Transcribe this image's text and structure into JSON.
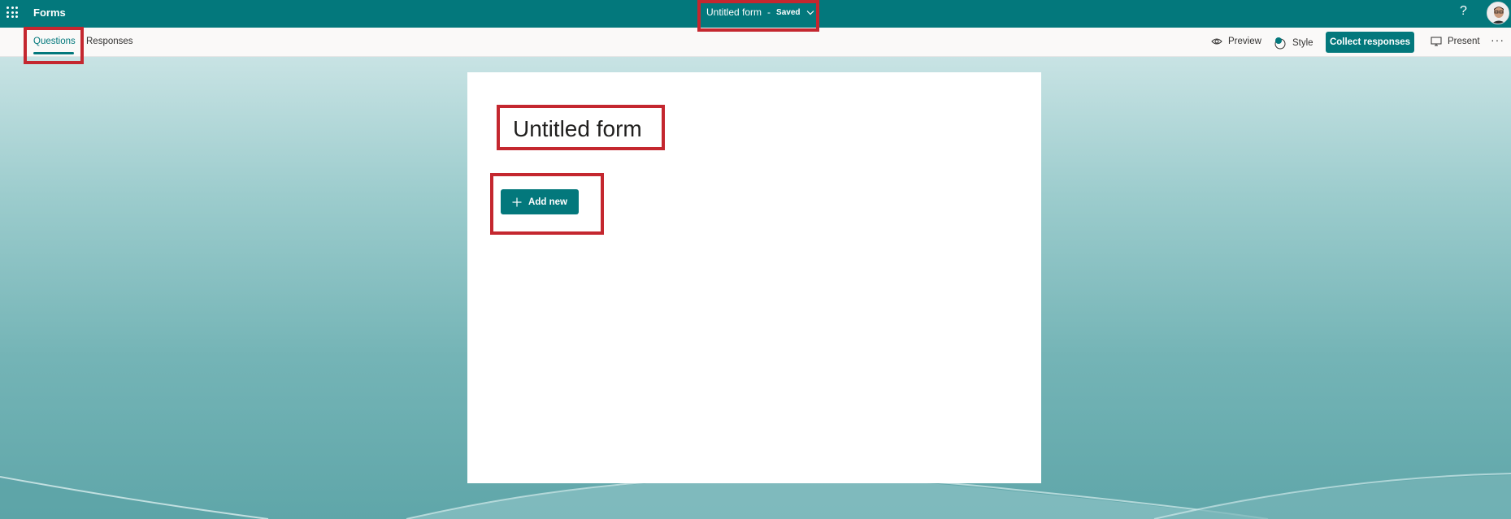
{
  "topbar": {
    "app_name": "Forms",
    "form_title": "Untitled form",
    "separator": "-",
    "save_status": "Saved",
    "help_label": "?"
  },
  "subbar": {
    "tabs": [
      {
        "label": "Questions",
        "active": true
      },
      {
        "label": "Responses",
        "active": false
      }
    ],
    "preview_label": "Preview",
    "style_label": "Style",
    "collect_label": "Collect responses",
    "present_label": "Present",
    "more_label": "···"
  },
  "form": {
    "title": "Untitled form",
    "add_new_label": "Add new"
  },
  "colors": {
    "brand": "#03787c",
    "highlight": "#c4272f"
  }
}
